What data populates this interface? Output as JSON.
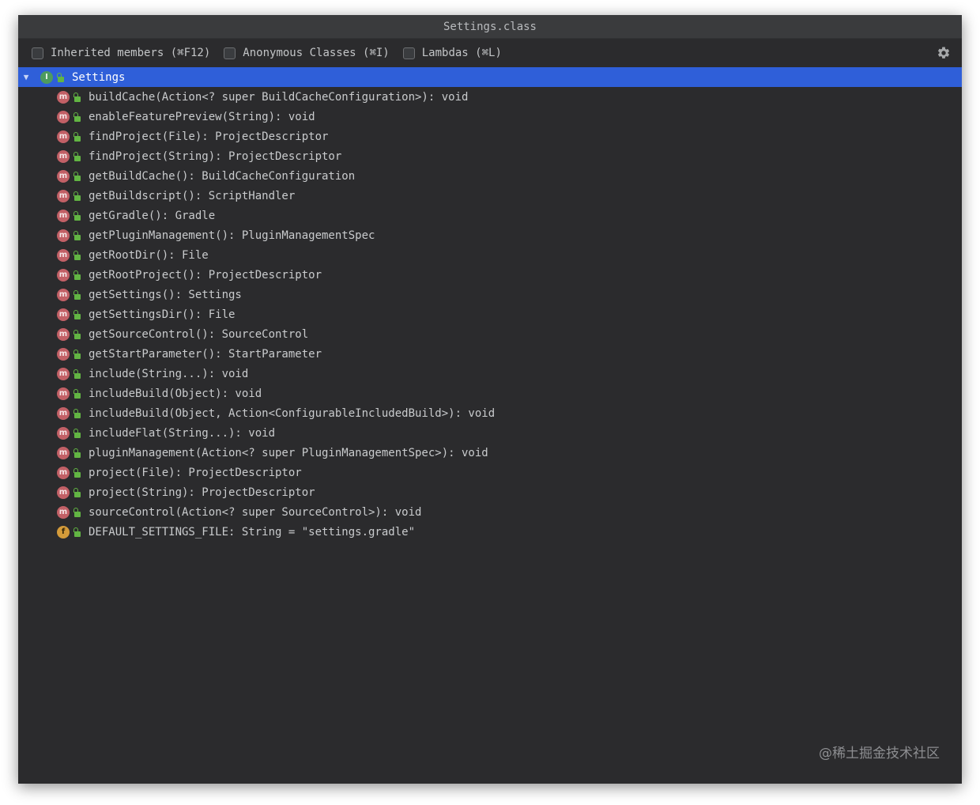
{
  "window": {
    "title": "Settings.class"
  },
  "toolbar": {
    "options": [
      {
        "label": "Inherited members (⌘F12)",
        "checked": false
      },
      {
        "label": "Anonymous Classes (⌘I)",
        "checked": false
      },
      {
        "label": "Lambdas (⌘L)",
        "checked": false
      }
    ],
    "settings_icon": "gear-icon"
  },
  "tree": {
    "root": {
      "label": "Settings",
      "icon_letter": "I",
      "icon": "interface-icon",
      "expanded": true
    },
    "members": [
      {
        "text": "buildCache(Action<? super BuildCacheConfiguration>): void",
        "kind": "method",
        "icon_letter": "m"
      },
      {
        "text": "enableFeaturePreview(String): void",
        "kind": "method",
        "icon_letter": "m"
      },
      {
        "text": "findProject(File): ProjectDescriptor",
        "kind": "method",
        "icon_letter": "m"
      },
      {
        "text": "findProject(String): ProjectDescriptor",
        "kind": "method",
        "icon_letter": "m"
      },
      {
        "text": "getBuildCache(): BuildCacheConfiguration",
        "kind": "method",
        "icon_letter": "m"
      },
      {
        "text": "getBuildscript(): ScriptHandler",
        "kind": "method",
        "icon_letter": "m"
      },
      {
        "text": "getGradle(): Gradle",
        "kind": "method",
        "icon_letter": "m"
      },
      {
        "text": "getPluginManagement(): PluginManagementSpec",
        "kind": "method",
        "icon_letter": "m"
      },
      {
        "text": "getRootDir(): File",
        "kind": "method",
        "icon_letter": "m"
      },
      {
        "text": "getRootProject(): ProjectDescriptor",
        "kind": "method",
        "icon_letter": "m"
      },
      {
        "text": "getSettings(): Settings",
        "kind": "method",
        "icon_letter": "m"
      },
      {
        "text": "getSettingsDir(): File",
        "kind": "method",
        "icon_letter": "m"
      },
      {
        "text": "getSourceControl(): SourceControl",
        "kind": "method",
        "icon_letter": "m"
      },
      {
        "text": "getStartParameter(): StartParameter",
        "kind": "method",
        "icon_letter": "m"
      },
      {
        "text": "include(String...): void",
        "kind": "method",
        "icon_letter": "m"
      },
      {
        "text": "includeBuild(Object): void",
        "kind": "method",
        "icon_letter": "m"
      },
      {
        "text": "includeBuild(Object, Action<ConfigurableIncludedBuild>): void",
        "kind": "method",
        "icon_letter": "m"
      },
      {
        "text": "includeFlat(String...): void",
        "kind": "method",
        "icon_letter": "m"
      },
      {
        "text": "pluginManagement(Action<? super PluginManagementSpec>): void",
        "kind": "method",
        "icon_letter": "m"
      },
      {
        "text": "project(File): ProjectDescriptor",
        "kind": "method",
        "icon_letter": "m"
      },
      {
        "text": "project(String): ProjectDescriptor",
        "kind": "method",
        "icon_letter": "m"
      },
      {
        "text": "sourceControl(Action<? super SourceControl>): void",
        "kind": "method",
        "icon_letter": "m"
      },
      {
        "text": "DEFAULT_SETTINGS_FILE: String = \"settings.gradle\"",
        "kind": "field",
        "icon_letter": "f"
      }
    ]
  },
  "watermark": "@稀土掘金技术社区",
  "colors": {
    "background": "#2b2b2d",
    "selection": "#2f5fd9",
    "method_icon": "#c26066",
    "field_icon": "#d49b3a",
    "interface_icon": "#4e9b5e",
    "public_lock": "#62b543"
  }
}
